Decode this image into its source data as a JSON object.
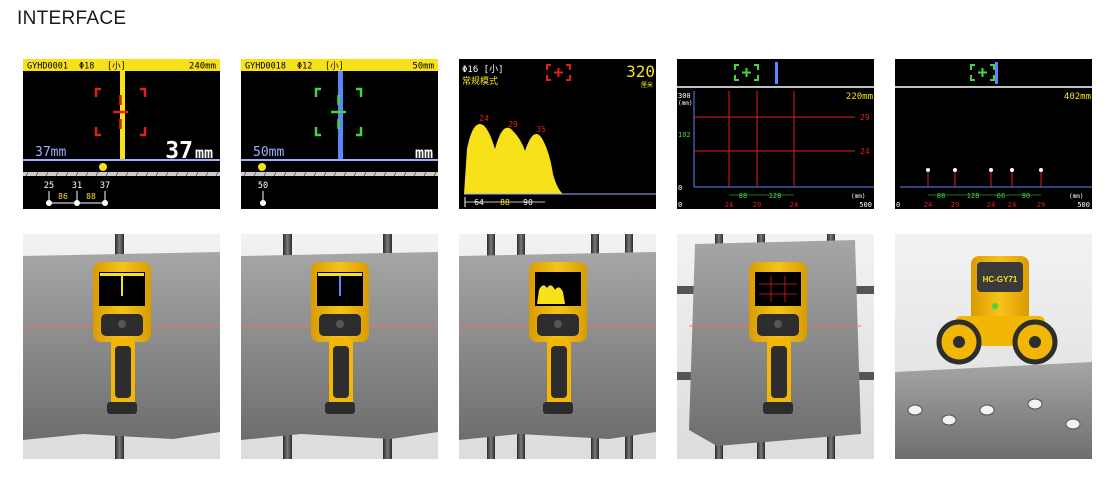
{
  "page": {
    "title": "INTERFACE"
  },
  "screens": {
    "s1": {
      "header_left": "GYHD0001",
      "header_dia": "Φ18",
      "header_mode": "[小]",
      "header_right": "240mm",
      "small_depth": "37mm",
      "big_depth": "37",
      "big_unit": "mm",
      "ticks": [
        "25",
        "31",
        "37"
      ],
      "spacings": [
        "86",
        "88"
      ]
    },
    "s2": {
      "header_left": "GYHD0018",
      "header_dia": "Φ12",
      "header_mode": "[小]",
      "header_right": "50mm",
      "small_depth": "50mm",
      "big_unit": "mm",
      "ticks": [
        "50"
      ]
    },
    "s3": {
      "header_dia": "Φ16 [小]",
      "mode_label": "常规模式",
      "value": "320",
      "unit": "厘米",
      "peaks": [
        "24",
        "29",
        "35"
      ],
      "spacings": [
        "64",
        "88",
        "90"
      ]
    },
    "s4": {
      "y_max": "300",
      "y_unit": "(mm)",
      "y_mid": "102",
      "y_zero": "0",
      "depth": "220mm",
      "right_labels": [
        "29",
        "24"
      ],
      "spacings": [
        "88",
        "128"
      ],
      "x_zero": "0",
      "x_unit": "(mm)",
      "x_max": "500",
      "bottom": [
        "24",
        "29",
        "24"
      ]
    },
    "s5": {
      "depth": "402mm",
      "spacings": [
        "88",
        "128",
        "66",
        "90"
      ],
      "x_unit": "(mm)",
      "x_zero": "0",
      "x_max": "500",
      "bottom": [
        "24",
        "29",
        "24",
        "24",
        "29"
      ]
    }
  },
  "photos": {
    "p5": {
      "brand_text": "HC-GY71"
    }
  },
  "colors": {
    "device_yellow": "#f2b705",
    "screen_yellow": "#f7e21a",
    "marker_red": "#e1201c",
    "marker_green": "#3fd63f",
    "baseline_blue": "#9bb0ff",
    "concrete": "#8f8f8f",
    "rebar": "#3b3b3b"
  }
}
